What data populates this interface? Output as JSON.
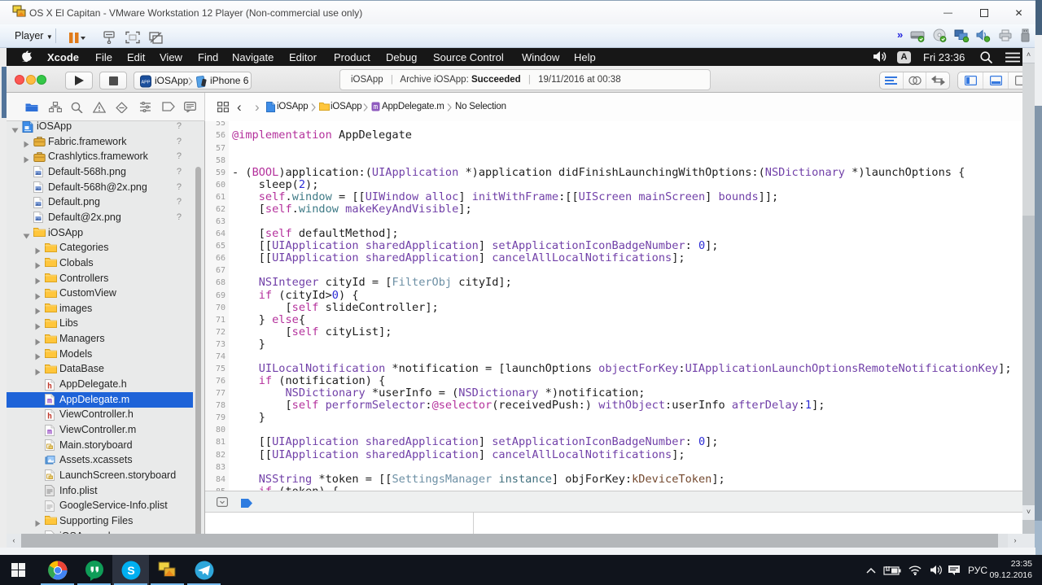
{
  "vmware": {
    "title": "OS X El Capitan - VMware Workstation 12 Player (Non-commercial use only)",
    "window_buttons": {
      "minimize": "—",
      "maximize": "❒",
      "close": "✕"
    },
    "toolbar": {
      "player_label": "Player",
      "left_icons": [
        "pause",
        "send-ctrl-alt-del",
        "fullscreen",
        "unity"
      ],
      "device_icons": [
        "hard-disk",
        "cd-rom",
        "network-displays",
        "sound",
        "printer",
        "usb"
      ]
    }
  },
  "macos": {
    "menubar": {
      "apple": "apple-logo",
      "items": [
        "Xcode",
        "File",
        "Edit",
        "View",
        "Find",
        "Navigate",
        "Editor",
        "Product",
        "Debug",
        "Source Control",
        "Window",
        "Help"
      ],
      "item_lefts": [
        50,
        109,
        148,
        188,
        235,
        277,
        347,
        402,
        466,
        524,
        633,
        697
      ],
      "right": {
        "input_badge": "A",
        "clock": "Fri 23:36"
      }
    }
  },
  "xcode": {
    "toolbar": {
      "scheme_target": "iOSApp",
      "scheme_destination": "iPhone 6",
      "activity_project": "iOSApp",
      "activity_message": "Archive iOSApp:",
      "activity_status": "Succeeded",
      "activity_detail": "19/11/2016 at 00:38"
    },
    "navigator_icons": [
      "project-navigator-folder",
      "symbol-navigator",
      "search-navigator",
      "issue-navigator",
      "test-navigator",
      "debug-navigator",
      "breakpoint-navigator",
      "report-navigator"
    ],
    "jumpbar": {
      "back": "‹",
      "forward": "›",
      "segments": [
        {
          "icon": "file-blue",
          "label": "iOSApp"
        },
        {
          "icon": "folder-small",
          "label": "iOSApp"
        },
        {
          "icon": "m-file-small",
          "label": "AppDelegate.m"
        },
        {
          "icon": null,
          "label": "No Selection"
        }
      ]
    },
    "tree": [
      {
        "level": 0,
        "disclosure": "open",
        "icon": "project",
        "label": "iOSApp",
        "badge": "?"
      },
      {
        "level": 1,
        "disclosure": "closed",
        "icon": "framework",
        "label": "Fabric.framework",
        "badge": "?"
      },
      {
        "level": 1,
        "disclosure": "closed",
        "icon": "framework",
        "label": "Crashlytics.framework",
        "badge": "?"
      },
      {
        "level": 1,
        "disclosure": null,
        "icon": "image-file",
        "label": "Default-568h.png",
        "badge": "?"
      },
      {
        "level": 1,
        "disclosure": null,
        "icon": "image-file",
        "label": "Default-568h@2x.png",
        "badge": "?"
      },
      {
        "level": 1,
        "disclosure": null,
        "icon": "image-file",
        "label": "Default.png",
        "badge": "?"
      },
      {
        "level": 1,
        "disclosure": null,
        "icon": "image-file",
        "label": "Default@2x.png",
        "badge": "?"
      },
      {
        "level": 1,
        "disclosure": "open",
        "icon": "folder",
        "label": "iOSApp",
        "badge": null
      },
      {
        "level": 2,
        "disclosure": "closed",
        "icon": "folder",
        "label": "Categories",
        "badge": null
      },
      {
        "level": 2,
        "disclosure": "closed",
        "icon": "folder",
        "label": "Clobals",
        "badge": null
      },
      {
        "level": 2,
        "disclosure": "closed",
        "icon": "folder",
        "label": "Controllers",
        "badge": null
      },
      {
        "level": 2,
        "disclosure": "closed",
        "icon": "folder",
        "label": "CustomView",
        "badge": null
      },
      {
        "level": 2,
        "disclosure": "closed",
        "icon": "folder",
        "label": "images",
        "badge": null
      },
      {
        "level": 2,
        "disclosure": "closed",
        "icon": "folder",
        "label": "Libs",
        "badge": null
      },
      {
        "level": 2,
        "disclosure": "closed",
        "icon": "folder",
        "label": "Managers",
        "badge": null
      },
      {
        "level": 2,
        "disclosure": "closed",
        "icon": "folder",
        "label": "Models",
        "badge": null
      },
      {
        "level": 2,
        "disclosure": "closed",
        "icon": "folder",
        "label": "DataBase",
        "badge": null
      },
      {
        "level": 2,
        "disclosure": null,
        "icon": "h-file",
        "label": "AppDelegate.h",
        "badge": null
      },
      {
        "level": 2,
        "disclosure": null,
        "icon": "m-file",
        "label": "AppDelegate.m",
        "badge": null,
        "selected": true
      },
      {
        "level": 2,
        "disclosure": null,
        "icon": "h-file",
        "label": "ViewController.h",
        "badge": null
      },
      {
        "level": 2,
        "disclosure": null,
        "icon": "m-file",
        "label": "ViewController.m",
        "badge": null
      },
      {
        "level": 2,
        "disclosure": null,
        "icon": "storyboard",
        "label": "Main.storyboard",
        "badge": null
      },
      {
        "level": 2,
        "disclosure": null,
        "icon": "assets",
        "label": "Assets.xcassets",
        "badge": null
      },
      {
        "level": 2,
        "disclosure": null,
        "icon": "storyboard",
        "label": "LaunchScreen.storyboard",
        "badge": null
      },
      {
        "level": 2,
        "disclosure": null,
        "icon": "plist",
        "label": "Info.plist",
        "badge": null
      },
      {
        "level": 2,
        "disclosure": null,
        "icon": "plist-light",
        "label": "GoogleService-Info.plist",
        "badge": null
      },
      {
        "level": 2,
        "disclosure": "closed",
        "icon": "folder",
        "label": "Supporting Files",
        "badge": null
      },
      {
        "level": 2,
        "disclosure": null,
        "icon": "pch-file",
        "label": "iOSApp.pch",
        "badge": null
      }
    ],
    "code": {
      "first_line": 55,
      "palette": {
        "p": "#1d1d1d",
        "k": "#b4319c",
        "c": "#7140a8",
        "n": "#2b2bd5",
        "t": "#3e7a86",
        "s": "#6c8fa4",
        "i": "#41707e",
        "d": "#74492f"
      },
      "lines": [
        [],
        [
          [
            "k",
            "@implementation"
          ],
          [
            "p",
            " AppDelegate"
          ]
        ],
        [],
        [],
        [
          [
            "p",
            "- ("
          ],
          [
            "k",
            "BOOL"
          ],
          [
            "p",
            ")application:("
          ],
          [
            "c",
            "UIApplication"
          ],
          [
            "p",
            " *)application didFinishLaunchingWithOptions:("
          ],
          [
            "c",
            "NSDictionary"
          ],
          [
            "p",
            " *)launchOptions {"
          ]
        ],
        [
          [
            "p",
            "    sleep("
          ],
          [
            "n",
            "2"
          ],
          [
            "p",
            ");"
          ]
        ],
        [
          [
            "p",
            "    "
          ],
          [
            "k",
            "self"
          ],
          [
            "p",
            "."
          ],
          [
            "t",
            "window"
          ],
          [
            "p",
            " = [["
          ],
          [
            "c",
            "UIWindow"
          ],
          [
            "p",
            " "
          ],
          [
            "c",
            "alloc"
          ],
          [
            "p",
            "] "
          ],
          [
            "c",
            "initWithFrame"
          ],
          [
            "p",
            ":[["
          ],
          [
            "c",
            "UIScreen"
          ],
          [
            "p",
            " "
          ],
          [
            "c",
            "mainScreen"
          ],
          [
            "p",
            "] "
          ],
          [
            "c",
            "bounds"
          ],
          [
            "p",
            "]];"
          ]
        ],
        [
          [
            "p",
            "    ["
          ],
          [
            "k",
            "self"
          ],
          [
            "p",
            "."
          ],
          [
            "t",
            "window"
          ],
          [
            "p",
            " "
          ],
          [
            "c",
            "makeKeyAndVisible"
          ],
          [
            "p",
            "];"
          ]
        ],
        [],
        [
          [
            "p",
            "    ["
          ],
          [
            "k",
            "self"
          ],
          [
            "p",
            " defaultMethod];"
          ]
        ],
        [
          [
            "p",
            "    [["
          ],
          [
            "c",
            "UIApplication"
          ],
          [
            "p",
            " "
          ],
          [
            "c",
            "sharedApplication"
          ],
          [
            "p",
            "] "
          ],
          [
            "c",
            "setApplicationIconBadgeNumber"
          ],
          [
            "p",
            ": "
          ],
          [
            "n",
            "0"
          ],
          [
            "p",
            "];"
          ]
        ],
        [
          [
            "p",
            "    [["
          ],
          [
            "c",
            "UIApplication"
          ],
          [
            "p",
            " "
          ],
          [
            "c",
            "sharedApplication"
          ],
          [
            "p",
            "] "
          ],
          [
            "c",
            "cancelAllLocalNotifications"
          ],
          [
            "p",
            "];"
          ]
        ],
        [],
        [
          [
            "p",
            "    "
          ],
          [
            "c",
            "NSInteger"
          ],
          [
            "p",
            " cityId = ["
          ],
          [
            "s",
            "FilterObj"
          ],
          [
            "p",
            " cityId];"
          ]
        ],
        [
          [
            "p",
            "    "
          ],
          [
            "k",
            "if"
          ],
          [
            "p",
            " (cityId>"
          ],
          [
            "n",
            "0"
          ],
          [
            "p",
            ") {"
          ]
        ],
        [
          [
            "p",
            "        ["
          ],
          [
            "k",
            "self"
          ],
          [
            "p",
            " slideController];"
          ]
        ],
        [
          [
            "p",
            "    } "
          ],
          [
            "k",
            "else"
          ],
          [
            "p",
            "{"
          ]
        ],
        [
          [
            "p",
            "        ["
          ],
          [
            "k",
            "self"
          ],
          [
            "p",
            " cityList];"
          ]
        ],
        [
          [
            "p",
            "    }"
          ]
        ],
        [],
        [
          [
            "p",
            "    "
          ],
          [
            "c",
            "UILocalNotification"
          ],
          [
            "p",
            " *notification = [launchOptions "
          ],
          [
            "c",
            "objectForKey"
          ],
          [
            "p",
            ":"
          ],
          [
            "c",
            "UIApplicationLaunchOptionsRemoteNotificationKey"
          ],
          [
            "p",
            "];"
          ]
        ],
        [
          [
            "p",
            "    "
          ],
          [
            "k",
            "if"
          ],
          [
            "p",
            " (notification) {"
          ]
        ],
        [
          [
            "p",
            "        "
          ],
          [
            "c",
            "NSDictionary"
          ],
          [
            "p",
            " *userInfo = ("
          ],
          [
            "c",
            "NSDictionary"
          ],
          [
            "p",
            " *)notification;"
          ]
        ],
        [
          [
            "p",
            "        ["
          ],
          [
            "k",
            "self"
          ],
          [
            "p",
            " "
          ],
          [
            "c",
            "performSelector"
          ],
          [
            "p",
            ":"
          ],
          [
            "k",
            "@selector"
          ],
          [
            "p",
            "(receivedPush:) "
          ],
          [
            "c",
            "withObject"
          ],
          [
            "p",
            ":userInfo "
          ],
          [
            "c",
            "afterDelay"
          ],
          [
            "p",
            ":"
          ],
          [
            "n",
            "1"
          ],
          [
            "p",
            "];"
          ]
        ],
        [
          [
            "p",
            "    }"
          ]
        ],
        [],
        [
          [
            "p",
            "    [["
          ],
          [
            "c",
            "UIApplication"
          ],
          [
            "p",
            " "
          ],
          [
            "c",
            "sharedApplication"
          ],
          [
            "p",
            "] "
          ],
          [
            "c",
            "setApplicationIconBadgeNumber"
          ],
          [
            "p",
            ": "
          ],
          [
            "n",
            "0"
          ],
          [
            "p",
            "];"
          ]
        ],
        [
          [
            "p",
            "    [["
          ],
          [
            "c",
            "UIApplication"
          ],
          [
            "p",
            " "
          ],
          [
            "c",
            "sharedApplication"
          ],
          [
            "p",
            "] "
          ],
          [
            "c",
            "cancelAllLocalNotifications"
          ],
          [
            "p",
            "];"
          ]
        ],
        [],
        [
          [
            "p",
            "    "
          ],
          [
            "c",
            "NSString"
          ],
          [
            "p",
            " *token = [["
          ],
          [
            "s",
            "SettingsManager"
          ],
          [
            "p",
            " "
          ],
          [
            "i",
            "instance"
          ],
          [
            "p",
            "] objForKey:"
          ],
          [
            "d",
            "kDeviceToken"
          ],
          [
            "p",
            "];"
          ]
        ],
        [
          [
            "p",
            "    "
          ],
          [
            "k",
            "if"
          ],
          [
            "p",
            " (token) {"
          ]
        ]
      ]
    }
  },
  "windows": {
    "taskbar": {
      "start": "start-button",
      "apps": [
        {
          "name": "chrome",
          "active": false
        },
        {
          "name": "hangouts",
          "active": false
        },
        {
          "name": "skype",
          "active": true
        },
        {
          "name": "vmware",
          "active": false
        },
        {
          "name": "telegram",
          "active": false
        }
      ],
      "tray": {
        "lang": "РУС",
        "time": "23:35",
        "date": "09.12.2016"
      }
    }
  }
}
